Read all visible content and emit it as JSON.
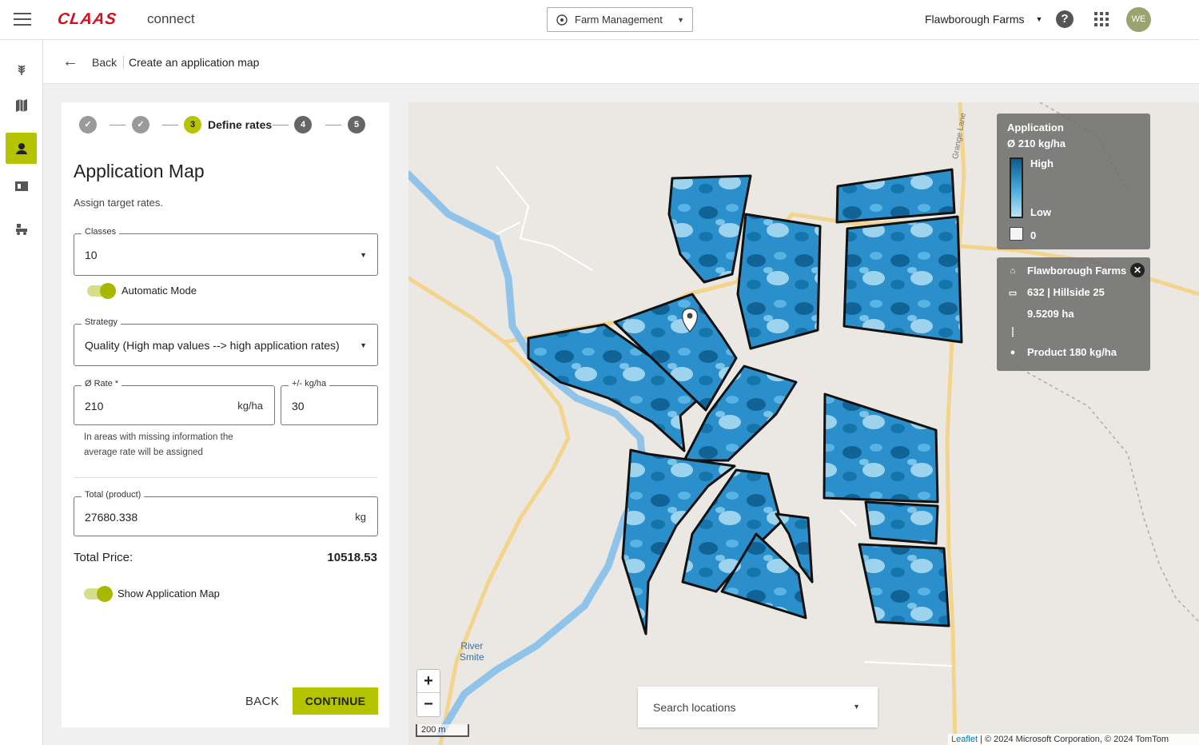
{
  "header": {
    "logo_text": "CLAAS",
    "app_name": "connect",
    "module_select": "Farm Management",
    "farm_select": "Flawborough Farms",
    "help_icon": "?",
    "avatar_initials": "WE"
  },
  "rail": {
    "items": [
      {
        "icon": "crop-icon",
        "active": false
      },
      {
        "icon": "map-icon",
        "active": false
      },
      {
        "icon": "application-map-icon",
        "active": true
      },
      {
        "icon": "folder-icon",
        "active": false
      },
      {
        "icon": "machines-icon",
        "active": false
      }
    ]
  },
  "breadcrumb": {
    "back": "Back",
    "title": "Create an application map"
  },
  "stepper": {
    "steps": [
      {
        "number": "1",
        "state": "done"
      },
      {
        "number": "2",
        "state": "done"
      },
      {
        "number": "3",
        "state": "current",
        "label": "Define rates"
      },
      {
        "number": "4",
        "state": "todo"
      },
      {
        "number": "5",
        "state": "todo"
      }
    ],
    "current_label": "Define rates"
  },
  "panel": {
    "title": "Application Map",
    "subtitle": "Assign target rates.",
    "classes": {
      "label": "Classes",
      "value": "10"
    },
    "automatic_mode": {
      "label": "Automatic Mode",
      "on": true
    },
    "strategy": {
      "label": "Strategy",
      "value": "Quality (High map values --> high application rates)"
    },
    "rate": {
      "label": "Ø Rate *",
      "value": "210",
      "unit": "kg/ha"
    },
    "tolerance": {
      "label": "+/- kg/ha",
      "value": "30"
    },
    "hint": "In areas with missing information the average rate will be assigned",
    "total": {
      "label": "Total (product)",
      "value": "27680.338",
      "unit": "kg"
    },
    "total_price_label": "Total Price:",
    "total_price_value": "10518.53",
    "show_map": {
      "label": "Show Application Map",
      "on": true
    },
    "back_button": "BACK",
    "continue_button": "CONTINUE"
  },
  "map": {
    "legend": {
      "title": "Application",
      "avg": "Ø 210 kg/ha",
      "high": "High",
      "low": "Low",
      "zero": "0"
    },
    "info": {
      "farm": "Flawborough Farms",
      "field": "632 | Hillside 25",
      "area": "9.5209 ha",
      "product": "Product 180 kg/ha"
    },
    "zoom_in": "+",
    "zoom_out": "−",
    "scale": "200 m",
    "search_placeholder": "Search locations",
    "river_label_1": "River",
    "river_label_2": "Smite",
    "lane_label": "Grange Lane",
    "attribution_leaflet": "Leaflet",
    "attribution_rest": " | © 2024 Microsoft Corporation, © 2024 TomTom"
  },
  "colors": {
    "accent": "#b5c400",
    "brand_red": "#d0101b",
    "field_dark": "#0d5c8c",
    "field_mid": "#2a8fcb",
    "field_light": "#bce3f5",
    "river": "#8fc3ea",
    "road": "#f5d99a"
  }
}
